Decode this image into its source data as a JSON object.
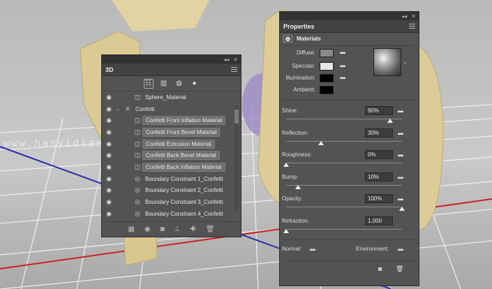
{
  "colors": {
    "panel_bg": "#535353",
    "header_bg": "#424242",
    "selection": "#6f6f6f",
    "axis_red": "#cc2222",
    "axis_blue": "#2233aa",
    "object_gold": "#dacb94"
  },
  "watermark": "www.hanyidianshejin.com",
  "panel3d": {
    "tab": "3D",
    "toolbar_icons": [
      "scene-icon",
      "mesh-icon",
      "materials-icon",
      "light-icon"
    ],
    "rows": [
      {
        "label": "Sphere_Material",
        "depth": 1,
        "icon": "material-icon",
        "selected": false,
        "twist": ""
      },
      {
        "label": "Confetti",
        "depth": 0,
        "icon": "mesh-icon",
        "selected": false,
        "twist": "⌄"
      },
      {
        "label": "Confetti Front Inflation Material",
        "depth": 1,
        "icon": "material-icon",
        "selected": true,
        "twist": ""
      },
      {
        "label": "Confetti Front Bevel Material",
        "depth": 1,
        "icon": "material-icon",
        "selected": true,
        "twist": ""
      },
      {
        "label": "Confetti Extrusion Material",
        "depth": 1,
        "icon": "material-icon",
        "selected": true,
        "twist": ""
      },
      {
        "label": "Confetti Back Bevel Material",
        "depth": 1,
        "icon": "material-icon",
        "selected": true,
        "twist": ""
      },
      {
        "label": "Confetti Back Inflation Material",
        "depth": 1,
        "icon": "material-icon",
        "selected": true,
        "twist": ""
      },
      {
        "label": "Boundary Constraint 1_Confetti",
        "depth": 1,
        "icon": "constraint-icon",
        "selected": false,
        "twist": ""
      },
      {
        "label": "Boundary Constraint 2_Confetti",
        "depth": 1,
        "icon": "constraint-icon",
        "selected": false,
        "twist": ""
      },
      {
        "label": "Boundary Constraint 3_Confetti",
        "depth": 1,
        "icon": "constraint-icon",
        "selected": false,
        "twist": ""
      },
      {
        "label": "Boundary Constraint 4_Confetti",
        "depth": 1,
        "icon": "constraint-icon",
        "selected": false,
        "twist": ""
      }
    ]
  },
  "properties": {
    "tab": "Properties",
    "section": "Materials",
    "diffuse_label": "Diffuse:",
    "specular_label": "Specular:",
    "illumination_label": "Illumination:",
    "ambient_label": "Ambient:",
    "diffuse_color": "#8a8a8a",
    "specular_color": "#e8e8e8",
    "illumination_color": "#000000",
    "ambient_color": "#000000",
    "sliders": [
      {
        "label": "Shine:",
        "value": "90%",
        "level": 0.9
      },
      {
        "label": "Reflection:",
        "value": "30%",
        "level": 0.3
      },
      {
        "label": "Roughness:",
        "value": "0%",
        "level": 0.0
      },
      {
        "label": "Bump:",
        "value": "10%",
        "level": 0.1
      },
      {
        "label": "Opacity:",
        "value": "100%",
        "level": 1.0
      },
      {
        "label": "Refraction:",
        "value": "1.000",
        "level": 0.0
      }
    ],
    "normal_label": "Normal:",
    "environment_label": "Environment:"
  }
}
